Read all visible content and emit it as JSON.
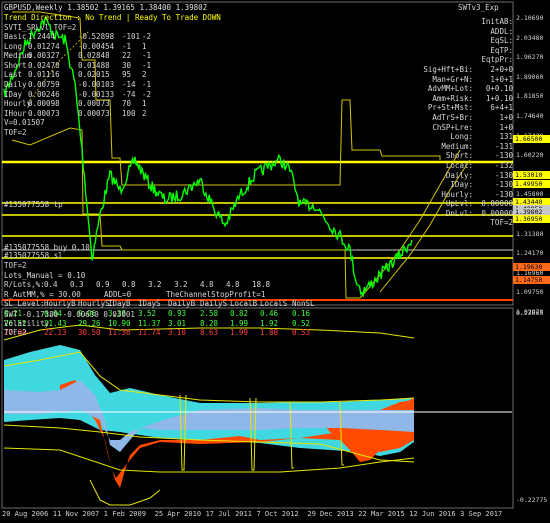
{
  "title": "GBPUSD,Weekly  1.38502 1.39165 1.38400 1.39802",
  "status_line": "Trend Direction : No Trend  |  Ready To Trade  DOWN",
  "indicator_name_top": "SWTv3_Exp",
  "svl_header": "SVTI_SRLvl_TOF=2",
  "left_table": {
    "rows": [
      {
        "label": "Basic",
        "a": "1.2444",
        "b": "-0.52898",
        "c": "-101",
        "d": "-2"
      },
      {
        "label": "Long",
        "a": "0.01274",
        "b": "-0.00454",
        "c": "-1",
        "d": "1"
      },
      {
        "label": "Medium",
        "a": "0.00327",
        "b": "0.02848",
        "c": "22",
        "d": "-1"
      },
      {
        "label": "Short",
        "a": "0.02470",
        "b": "0.01488",
        "c": "30",
        "d": "-1"
      },
      {
        "label": "Last",
        "a": "0.01116",
        "b": "0.02015",
        "c": "95",
        "d": "2"
      },
      {
        "label": "Daily",
        "a": "0.00759",
        "b": "-0.00103",
        "c": "-14",
        "d": "-1"
      },
      {
        "label": "IDay",
        "a": "0.00246",
        "b": "-0.00133",
        "c": "-74",
        "d": "-2"
      },
      {
        "label": "Hourly",
        "a": "0.00098",
        "b": "0.00073",
        "c": "70",
        "d": "1"
      },
      {
        "label": "IHour",
        "a": "0.00073",
        "b": "0.00073",
        "c": "100",
        "d": "2"
      }
    ],
    "v_line": "V=0.01507",
    "tof_line": "TOF=2"
  },
  "right_panel": [
    {
      "label": "InitAB:",
      "value": ""
    },
    {
      "label": "ADDL:",
      "value": ""
    },
    {
      "label": "EqSL:",
      "value": ""
    },
    {
      "label": "EqTP:",
      "value": ""
    },
    {
      "label": "EqtpPr:",
      "value": ""
    },
    {
      "label": "Sig+Hft+Bi:",
      "value": "2+0+0"
    },
    {
      "label": "Man+Gr+N:",
      "value": "1+0+1"
    },
    {
      "label": "AdvMM+Lot:",
      "value": "0+0.10"
    },
    {
      "label": "Amm+Risk:",
      "value": "1+0.10"
    },
    {
      "label": "Pr+St+Mst:",
      "value": "6+4+1"
    },
    {
      "label": "AdTrS+Br:",
      "value": "1+0"
    },
    {
      "label": "ChSP+Lre:",
      "value": "1+0"
    },
    {
      "label": "Long:",
      "value": "131"
    },
    {
      "label": "Medium:",
      "value": "-131"
    },
    {
      "label": "Short:",
      "value": "-130"
    },
    {
      "label": "Local:",
      "value": "-132"
    },
    {
      "label": "Daily:",
      "value": "-130"
    },
    {
      "label": "IDay:",
      "value": "-130"
    },
    {
      "label": "Hourly:",
      "value": "-130"
    },
    {
      "label": "UpLvl:",
      "value": "0.00000"
    },
    {
      "label": "DnLvl:",
      "value": "0.00000"
    },
    {
      "label": "TOF=2",
      "value": ""
    }
  ],
  "order_labels": {
    "tp": "#135077558 tp",
    "buy": "#135077558 buy 0.10",
    "sl": "#135077558 sl"
  },
  "bottom_params": {
    "tof": "TOF=2",
    "lots": "Lots_Manual = 0.10",
    "rlots_label": "R/Lots,%:",
    "rlots_values": [
      "0.4",
      "0.3",
      "0.9",
      "0.8",
      "3.2",
      "3.2",
      "4.8",
      "4.8",
      "18.8"
    ],
    "autoMM": "R_AutMM,% = 30.00",
    "addl": "ADDL=0",
    "channel_stop": "TheChannelStopProfit=1",
    "sl_header": [
      "SL_Level:",
      "HourlyB",
      "HourlyS",
      "IDayB",
      "IDayS",
      "DailyB",
      "DailyS",
      "LocalB",
      "LocalS",
      "NonSL"
    ],
    "sl_rows": [
      {
        "color": "green",
        "values": [
          "8.21",
          "6.64",
          "9.06",
          "3.38",
          "3.52",
          "0.93",
          "2.58",
          "0.82",
          "0.46",
          "0.16"
        ]
      },
      {
        "color": "green",
        "values": [
          "26.52",
          "21.43",
          "29.26",
          "10.90",
          "11.37",
          "3.01",
          "8.28",
          "1.99",
          "1.92",
          "0.52"
        ]
      },
      {
        "color": "red",
        "values": [
          "27.80",
          "22.13",
          "30.50",
          "11.36",
          "11.74",
          "3.10",
          "8.63",
          "1.99",
          "1.88",
          "0.53"
        ]
      }
    ]
  },
  "price_scale": [
    "2.10690",
    "2.03480",
    "1.96270",
    "1.89060",
    "1.81850",
    "1.74640",
    "1.67430",
    "1.60220",
    "1.53010",
    "1.45800",
    "1.38590",
    "1.31380",
    "1.24170",
    "1.16960",
    "1.09750",
    "1.02970"
  ],
  "price_tags": [
    {
      "text": "1.66500",
      "bg": "#ffff00"
    },
    {
      "text": "1.53010",
      "bg": "#ffff00"
    },
    {
      "text": "1.49950",
      "bg": "#ffff00"
    },
    {
      "text": "1.43440",
      "bg": "#ffff00"
    },
    {
      "text": "1.40850",
      "bg": "#c8c8c8"
    },
    {
      "text": "1.39802",
      "bg": "#c8c8c8"
    },
    {
      "text": "1.36950",
      "bg": "#ffff00"
    },
    {
      "text": "1.19630",
      "bg": "#ff6a1a"
    },
    {
      "text": "1.14750",
      "bg": "#ff6a1a"
    }
  ],
  "sub_header": "SWT -0.17380 -0.00630 0.03001",
  "sub_lines": [
    "Volatility",
    "TOF=2"
  ],
  "sub_scale": [
    "0.23665",
    "-0.22775"
  ],
  "x_axis": [
    "20 Aug 2006",
    "11 Nov 2007",
    "1 Feb 2009",
    "25 Apr 2010",
    "17 Jul 2011",
    "7 Oct 2012",
    "29 Dec 2013",
    "22 Mar 2015",
    "12 Jun 2016",
    "3 Sep 2017"
  ],
  "colors": {
    "price": "#00ff00",
    "levels": "#ffff00",
    "stop": "#ff4000",
    "cyan": "#40e0e0",
    "orange": "#ff4a00",
    "blue": "#8fb8e8"
  }
}
